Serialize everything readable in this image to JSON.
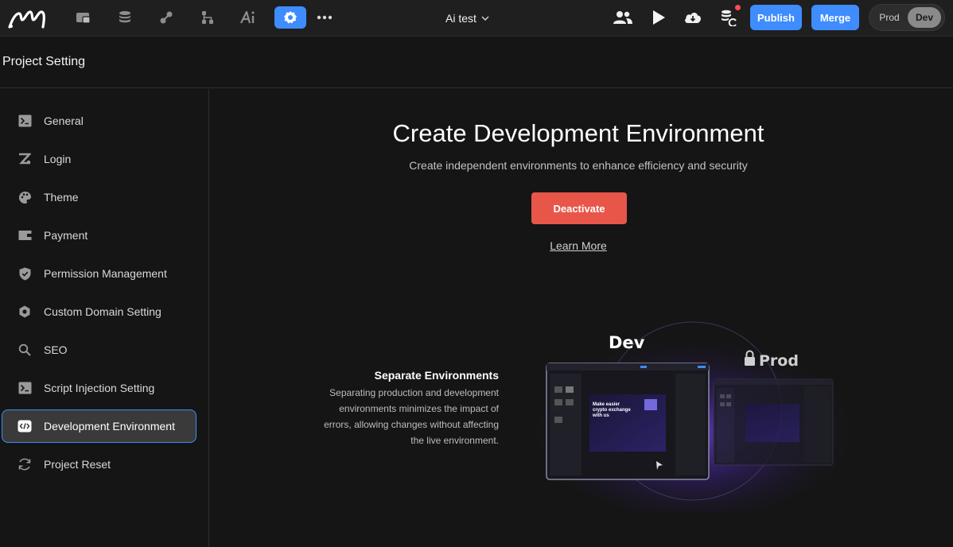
{
  "topbar": {
    "project_name": "Ai test",
    "publish_label": "Publish",
    "merge_label": "Merge",
    "env_prod_label": "Prod",
    "env_dev_label": "Dev",
    "icons": [
      "logo",
      "pages-icon",
      "database-icon",
      "api-icon",
      "workflow-icon",
      "ai-icon",
      "settings-icon",
      "more-icon",
      "users-icon",
      "play-icon",
      "cloud-download-icon",
      "database-sync-icon"
    ],
    "accent_color": "#3f8cff"
  },
  "header": {
    "title": "Project Setting"
  },
  "sidebar": {
    "items": [
      {
        "label": "General",
        "icon": "terminal-icon"
      },
      {
        "label": "Login",
        "icon": "login-icon"
      },
      {
        "label": "Theme",
        "icon": "palette-icon"
      },
      {
        "label": "Payment",
        "icon": "wallet-icon"
      },
      {
        "label": "Permission Management",
        "icon": "shield-icon"
      },
      {
        "label": "Custom Domain Setting",
        "icon": "domain-icon"
      },
      {
        "label": "SEO",
        "icon": "search-icon"
      },
      {
        "label": "Script Injection Setting",
        "icon": "terminal-icon"
      },
      {
        "label": "Development Environment",
        "icon": "code-icon",
        "active": true
      },
      {
        "label": "Project Reset",
        "icon": "reset-icon"
      }
    ]
  },
  "main": {
    "title": "Create Development Environment",
    "subtitle": "Create independent environments to enhance efficiency and security",
    "deactivate_label": "Deactivate",
    "learn_more_label": "Learn More",
    "feature": {
      "title": "Separate Environments",
      "desc_lines": [
        "Separating production and development",
        "environments minimizes the impact of",
        "errors, allowing changes without affecting",
        "the live environment."
      ]
    },
    "illustration": {
      "dev_label": "Dev",
      "prod_label": "Prod",
      "screen_text_line1": "Make easier",
      "screen_text_line2": "crypto exchange",
      "screen_text_line3": "with us"
    },
    "deactivate_color": "#e8564a"
  }
}
